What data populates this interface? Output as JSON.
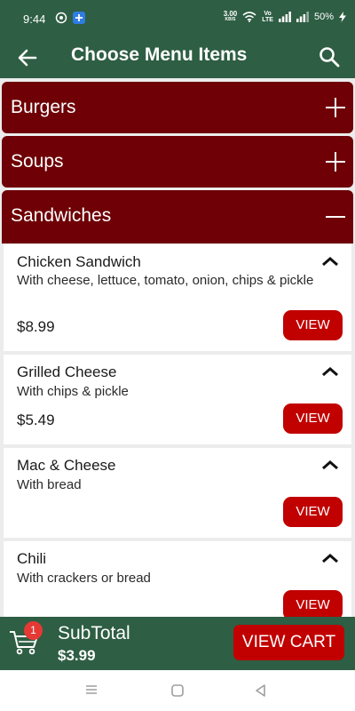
{
  "status_bar": {
    "time": "9:44",
    "speed": "3.00",
    "speed_unit": "KB/S",
    "volte_line1": "Vo",
    "volte_line2": "LTE",
    "battery": "50%"
  },
  "app_bar": {
    "title": "Choose Menu Items",
    "back_icon": "arrow-left-icon",
    "search_icon": "search-icon"
  },
  "categories": [
    {
      "label": "Burgers",
      "state": "collapsed"
    },
    {
      "label": "Soups",
      "state": "collapsed"
    },
    {
      "label": "Sandwiches",
      "state": "expanded"
    }
  ],
  "items": [
    {
      "name": "Chicken Sandwich",
      "description": "With cheese, lettuce, tomato, onion, chips & pickle",
      "price": "$8.99",
      "button": "VIEW"
    },
    {
      "name": "Grilled Cheese",
      "description": "With chips & pickle",
      "price": "$5.49",
      "button": "VIEW"
    },
    {
      "name": "Mac & Cheese",
      "description": "With bread",
      "price": "",
      "button": "VIEW"
    },
    {
      "name": "Chili",
      "description": "With crackers or bread",
      "price": "",
      "button": "VIEW"
    }
  ],
  "cart": {
    "badge_count": "1",
    "subtotal_label": "SubTotal",
    "subtotal_value": "$3.99",
    "view_cart_label": "VIEW CART"
  },
  "colors": {
    "app_green": "#2e5e43",
    "category_red": "#6e0006",
    "button_red": "#c10000",
    "badge_red": "#e53935"
  }
}
